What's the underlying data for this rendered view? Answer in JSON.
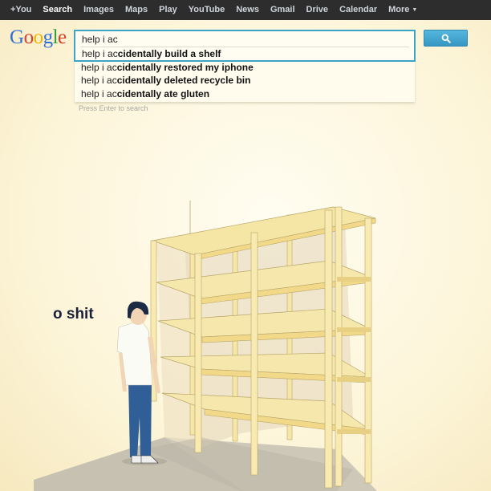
{
  "nav": {
    "items": [
      {
        "label": "+You"
      },
      {
        "label": "Search"
      },
      {
        "label": "Images"
      },
      {
        "label": "Maps"
      },
      {
        "label": "Play"
      },
      {
        "label": "YouTube"
      },
      {
        "label": "News"
      },
      {
        "label": "Gmail"
      },
      {
        "label": "Drive"
      },
      {
        "label": "Calendar"
      },
      {
        "label": "More"
      }
    ]
  },
  "logo": {
    "letters": [
      "G",
      "o",
      "o",
      "g",
      "l",
      "e"
    ],
    "colors": [
      "#2f6fd6",
      "#d9412b",
      "#f1b400",
      "#2f6fd6",
      "#2f9d3c",
      "#d9412b"
    ]
  },
  "search": {
    "query": "help i ac",
    "suggestions": [
      {
        "prefix": "help i ac",
        "completion": "cidentally build a shelf"
      },
      {
        "prefix": "help i ac",
        "completion": "cidentally restored my iphone"
      },
      {
        "prefix": "help i ac",
        "completion": "cidentally deleted recycle bin"
      },
      {
        "prefix": "help i ac",
        "completion": "cidentally ate gluten"
      }
    ],
    "hint": "Press Enter to search",
    "button_icon": "search-icon",
    "accent_color": "#3ea4c7"
  },
  "scene": {
    "caption": "o shit"
  }
}
